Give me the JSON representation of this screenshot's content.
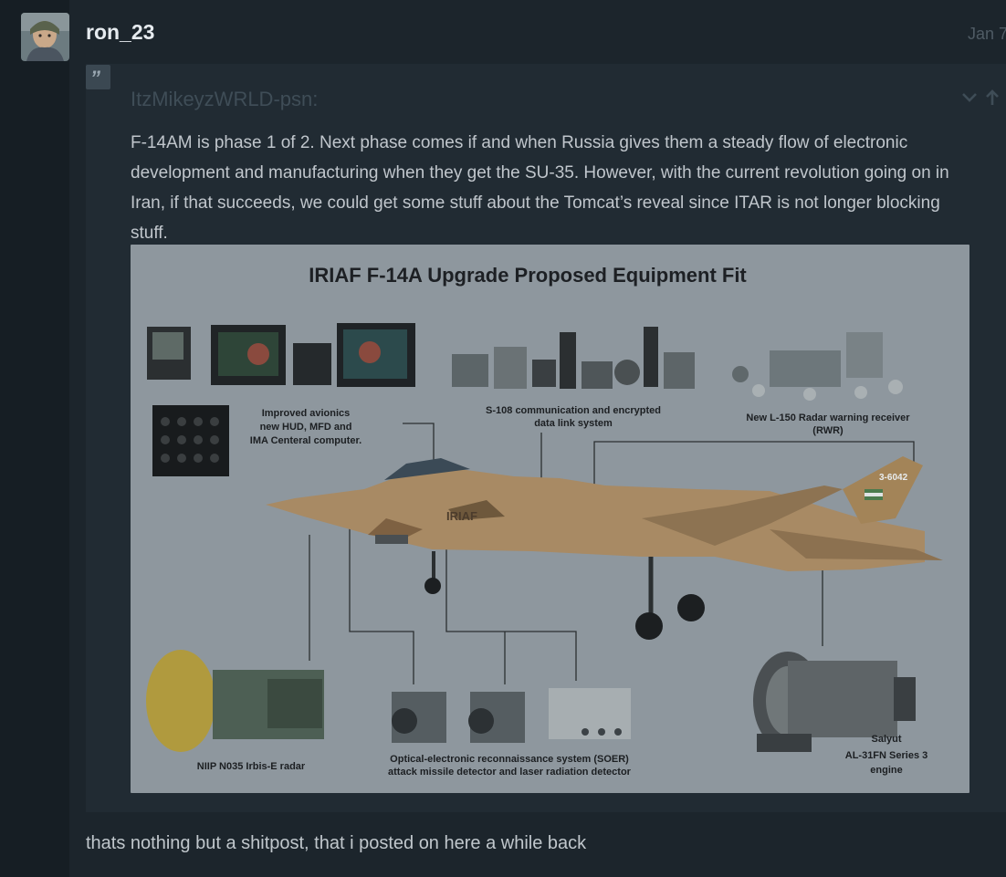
{
  "post": {
    "username": "ron_23",
    "date": "Jan 7",
    "quote": {
      "author": "ItzMikeyzWRLD-psn:",
      "text": "F-14AM is phase 1 of 2. Next phase comes if and when Russia gives them a steady flow of electronic development and manufacturing when they get the SU-35. However, with the current revolution going on in Iran, if that succeeds, we could get some stuff about the Tomcat’s reveal since ITAR is not longer blocking stuff.",
      "image": {
        "title": "IRIAF F-14A Upgrade Proposed Equipment Fit",
        "fuselage_marking": "IRIAF",
        "tail_number": "3-6042",
        "labels": {
          "avionics": [
            "Improved avionics",
            "new HUD, MFD and",
            "IMA Centeral computer."
          ],
          "s108": [
            "S-108 communication and encrypted",
            "data link system"
          ],
          "rwr": [
            "New L-150 Radar warning receiver",
            "(RWR)"
          ],
          "radar": [
            "NIIP N035 Irbis-E radar"
          ],
          "soer": [
            "Optical-electronic reconnaissance system (SOER)",
            "attack missile detector and laser radiation detector"
          ],
          "engine": [
            "Salyut",
            "AL-31FN Series 3",
            "engine"
          ]
        }
      }
    },
    "reply_text": "thats nothing but a shitpost, that i posted on here a while back"
  }
}
